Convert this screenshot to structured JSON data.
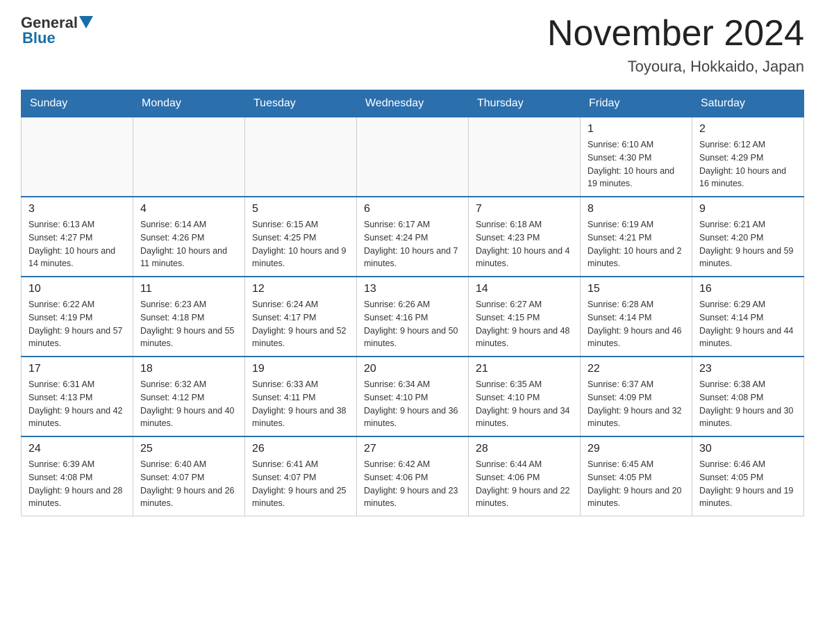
{
  "header": {
    "logo_general": "General",
    "logo_blue": "Blue",
    "month_title": "November 2024",
    "location": "Toyoura, Hokkaido, Japan"
  },
  "weekdays": [
    "Sunday",
    "Monday",
    "Tuesday",
    "Wednesday",
    "Thursday",
    "Friday",
    "Saturday"
  ],
  "weeks": [
    [
      {
        "day": "",
        "info": ""
      },
      {
        "day": "",
        "info": ""
      },
      {
        "day": "",
        "info": ""
      },
      {
        "day": "",
        "info": ""
      },
      {
        "day": "",
        "info": ""
      },
      {
        "day": "1",
        "info": "Sunrise: 6:10 AM\nSunset: 4:30 PM\nDaylight: 10 hours and 19 minutes."
      },
      {
        "day": "2",
        "info": "Sunrise: 6:12 AM\nSunset: 4:29 PM\nDaylight: 10 hours and 16 minutes."
      }
    ],
    [
      {
        "day": "3",
        "info": "Sunrise: 6:13 AM\nSunset: 4:27 PM\nDaylight: 10 hours and 14 minutes."
      },
      {
        "day": "4",
        "info": "Sunrise: 6:14 AM\nSunset: 4:26 PM\nDaylight: 10 hours and 11 minutes."
      },
      {
        "day": "5",
        "info": "Sunrise: 6:15 AM\nSunset: 4:25 PM\nDaylight: 10 hours and 9 minutes."
      },
      {
        "day": "6",
        "info": "Sunrise: 6:17 AM\nSunset: 4:24 PM\nDaylight: 10 hours and 7 minutes."
      },
      {
        "day": "7",
        "info": "Sunrise: 6:18 AM\nSunset: 4:23 PM\nDaylight: 10 hours and 4 minutes."
      },
      {
        "day": "8",
        "info": "Sunrise: 6:19 AM\nSunset: 4:21 PM\nDaylight: 10 hours and 2 minutes."
      },
      {
        "day": "9",
        "info": "Sunrise: 6:21 AM\nSunset: 4:20 PM\nDaylight: 9 hours and 59 minutes."
      }
    ],
    [
      {
        "day": "10",
        "info": "Sunrise: 6:22 AM\nSunset: 4:19 PM\nDaylight: 9 hours and 57 minutes."
      },
      {
        "day": "11",
        "info": "Sunrise: 6:23 AM\nSunset: 4:18 PM\nDaylight: 9 hours and 55 minutes."
      },
      {
        "day": "12",
        "info": "Sunrise: 6:24 AM\nSunset: 4:17 PM\nDaylight: 9 hours and 52 minutes."
      },
      {
        "day": "13",
        "info": "Sunrise: 6:26 AM\nSunset: 4:16 PM\nDaylight: 9 hours and 50 minutes."
      },
      {
        "day": "14",
        "info": "Sunrise: 6:27 AM\nSunset: 4:15 PM\nDaylight: 9 hours and 48 minutes."
      },
      {
        "day": "15",
        "info": "Sunrise: 6:28 AM\nSunset: 4:14 PM\nDaylight: 9 hours and 46 minutes."
      },
      {
        "day": "16",
        "info": "Sunrise: 6:29 AM\nSunset: 4:14 PM\nDaylight: 9 hours and 44 minutes."
      }
    ],
    [
      {
        "day": "17",
        "info": "Sunrise: 6:31 AM\nSunset: 4:13 PM\nDaylight: 9 hours and 42 minutes."
      },
      {
        "day": "18",
        "info": "Sunrise: 6:32 AM\nSunset: 4:12 PM\nDaylight: 9 hours and 40 minutes."
      },
      {
        "day": "19",
        "info": "Sunrise: 6:33 AM\nSunset: 4:11 PM\nDaylight: 9 hours and 38 minutes."
      },
      {
        "day": "20",
        "info": "Sunrise: 6:34 AM\nSunset: 4:10 PM\nDaylight: 9 hours and 36 minutes."
      },
      {
        "day": "21",
        "info": "Sunrise: 6:35 AM\nSunset: 4:10 PM\nDaylight: 9 hours and 34 minutes."
      },
      {
        "day": "22",
        "info": "Sunrise: 6:37 AM\nSunset: 4:09 PM\nDaylight: 9 hours and 32 minutes."
      },
      {
        "day": "23",
        "info": "Sunrise: 6:38 AM\nSunset: 4:08 PM\nDaylight: 9 hours and 30 minutes."
      }
    ],
    [
      {
        "day": "24",
        "info": "Sunrise: 6:39 AM\nSunset: 4:08 PM\nDaylight: 9 hours and 28 minutes."
      },
      {
        "day": "25",
        "info": "Sunrise: 6:40 AM\nSunset: 4:07 PM\nDaylight: 9 hours and 26 minutes."
      },
      {
        "day": "26",
        "info": "Sunrise: 6:41 AM\nSunset: 4:07 PM\nDaylight: 9 hours and 25 minutes."
      },
      {
        "day": "27",
        "info": "Sunrise: 6:42 AM\nSunset: 4:06 PM\nDaylight: 9 hours and 23 minutes."
      },
      {
        "day": "28",
        "info": "Sunrise: 6:44 AM\nSunset: 4:06 PM\nDaylight: 9 hours and 22 minutes."
      },
      {
        "day": "29",
        "info": "Sunrise: 6:45 AM\nSunset: 4:05 PM\nDaylight: 9 hours and 20 minutes."
      },
      {
        "day": "30",
        "info": "Sunrise: 6:46 AM\nSunset: 4:05 PM\nDaylight: 9 hours and 19 minutes."
      }
    ]
  ]
}
